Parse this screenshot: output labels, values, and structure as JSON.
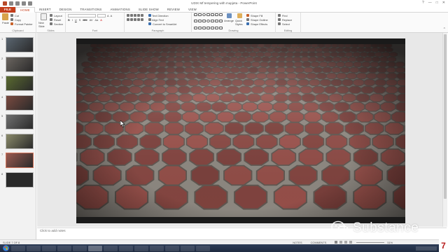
{
  "window": {
    "title": "UDIX Mf tempering with mupjeta - PowerPoint",
    "controls": [
      "?",
      "—",
      "□",
      "✕"
    ]
  },
  "tabs": [
    "FILE",
    "HOME",
    "INSERT",
    "DESIGN",
    "TRANSITIONS",
    "ANIMATIONS",
    "SLIDE SHOW",
    "REVIEW",
    "VIEW"
  ],
  "active_tab": "HOME",
  "ribbon": {
    "clipboard": {
      "label": "Clipboard",
      "paste": "Paste",
      "cut": "Cut",
      "copy": "Copy",
      "format_painter": "Format Painter"
    },
    "slides": {
      "label": "Slides",
      "new_slide": "New Slide",
      "layout": "Layout",
      "reset": "Reset",
      "section": "Section"
    },
    "font": {
      "label": "Font",
      "bold": "B",
      "italic": "I",
      "underline": "U",
      "strike": "S",
      "abc": "abc",
      "av": "AV",
      "aa": "Aa",
      "a": "A"
    },
    "paragraph": {
      "label": "Paragraph",
      "text_direction": "Text Direction",
      "align_text": "Align Text",
      "convert_smartart": "Convert to SmartArt"
    },
    "drawing": {
      "label": "Drawing",
      "arrange": "Arrange",
      "quick_styles": "Quick Styles",
      "shape_fill": "Shape Fill",
      "shape_outline": "Shape Outline",
      "shape_effects": "Shape Effects"
    },
    "editing": {
      "label": "Editing",
      "find": "Find",
      "replace": "Replace",
      "select": "Select"
    }
  },
  "slides": [
    {
      "num": "1",
      "color": "#5a6570",
      "selected": false
    },
    {
      "num": "2",
      "color": "#6b6560",
      "selected": false
    },
    {
      "num": "3",
      "color": "#5a6a30",
      "selected": false
    },
    {
      "num": "4",
      "color": "#7a4a40",
      "selected": false
    },
    {
      "num": "5",
      "color": "#707070",
      "selected": false
    },
    {
      "num": "6",
      "color": "#8a8a6a",
      "selected": false
    },
    {
      "num": "7",
      "color": "#9a5a50",
      "selected": true
    },
    {
      "num": "8",
      "color": "#2a2a2a",
      "selected": false
    }
  ],
  "notes": {
    "placeholder": "Click to add notes"
  },
  "status": {
    "slide_info": "SLIDE 7 OF 8",
    "notes": "NOTES",
    "comments": "COMMENTS",
    "zoom": "51%"
  },
  "watermark": {
    "text": "Substance"
  },
  "logo": {
    "text": "7"
  },
  "colors": {
    "accent": "#c43e1c",
    "taskbar": "#1e2a40",
    "brick": "#8a4a40",
    "mortar": "#8c8780"
  }
}
